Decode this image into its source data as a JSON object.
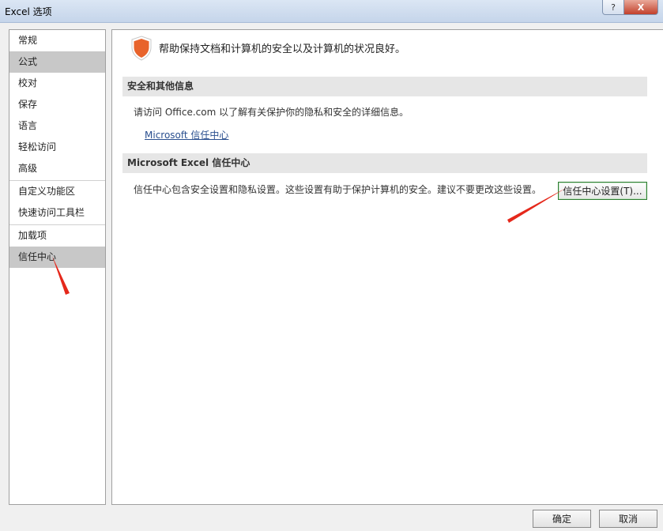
{
  "window": {
    "title": "Excel 选项",
    "help_label": "?",
    "close_label": "X"
  },
  "nav": {
    "items": [
      "常规",
      "公式",
      "校对",
      "保存",
      "语言",
      "轻松访问",
      "高级",
      "自定义功能区",
      "快速访问工具栏",
      "加载项",
      "信任中心"
    ]
  },
  "content": {
    "intro": "帮助保持文档和计算机的安全以及计算机的状况良好。",
    "section1": {
      "header": "安全和其他信息",
      "text": "请访问 Office.com  以了解有关保护你的隐私和安全的详细信息。",
      "link": "Microsoft 信任中心"
    },
    "section2": {
      "header": "Microsoft Excel 信任中心",
      "text": "信任中心包含安全设置和隐私设置。这些设置有助于保护计算机的安全。建议不要更改这些设置。",
      "button": "信任中心设置(T)..."
    }
  },
  "footer": {
    "ok_label": "确定",
    "cancel_label": "取消"
  },
  "colors": {
    "shield": "#e8632b",
    "annotation_arrow": "#e5281b",
    "selected_nav": "#c8c8c8",
    "link": "#2a4f8f"
  },
  "icons": {
    "shield": "shield-icon"
  }
}
